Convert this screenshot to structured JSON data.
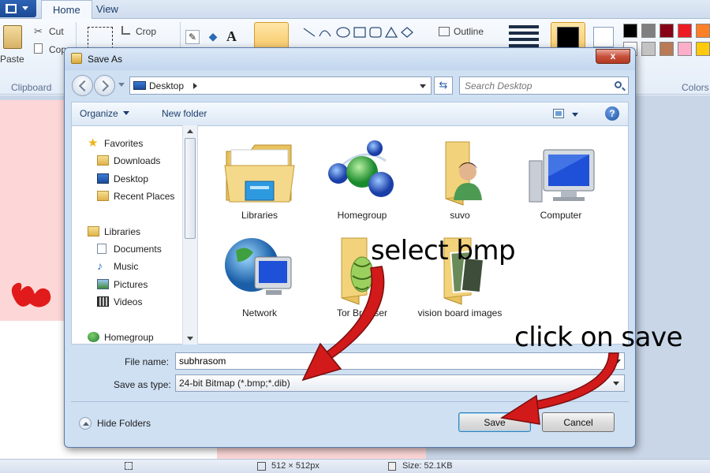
{
  "paint": {
    "tabs": [
      "Home",
      "View"
    ],
    "ribbon": {
      "paste_label": "Paste",
      "cut_label": "Cut",
      "copy_label": "Cop",
      "crop_label": "Crop",
      "outline_label": "Outline",
      "clipboard_group": "Clipboard",
      "colors_group": "Colors"
    },
    "palette": [
      "#000000",
      "#7f7f7f",
      "#880015",
      "#ed1c24",
      "#ff7f27",
      "#ffffff",
      "#c3c3c3",
      "#b97a57",
      "#ffaec9",
      "#ffc90e"
    ],
    "status": {
      "dimensions": "512 × 512px",
      "size": "Size: 52.1KB"
    }
  },
  "dialog": {
    "title": "Save As",
    "close_label": "x",
    "address": {
      "location": "Desktop"
    },
    "search": {
      "placeholder": "Search Desktop"
    },
    "toolbar": {
      "organize_label": "Organize",
      "new_folder_label": "New folder",
      "help_label": "?"
    },
    "nav_pane": {
      "items": [
        {
          "label": "Favorites",
          "icon": "star-icon"
        },
        {
          "label": "Downloads",
          "icon": "downloads-folder-icon"
        },
        {
          "label": "Desktop",
          "icon": "desktop-icon"
        },
        {
          "label": "Recent Places",
          "icon": "recent-places-icon"
        },
        {
          "label": "Libraries",
          "icon": "libraries-icon"
        },
        {
          "label": "Documents",
          "icon": "documents-icon"
        },
        {
          "label": "Music",
          "icon": "music-icon"
        },
        {
          "label": "Pictures",
          "icon": "pictures-icon"
        },
        {
          "label": "Videos",
          "icon": "videos-icon"
        },
        {
          "label": "Homegroup",
          "icon": "homegroup-icon"
        }
      ]
    },
    "files": [
      {
        "label": "Libraries",
        "icon": "libraries-folder-icon"
      },
      {
        "label": "Homegroup",
        "icon": "homegroup-spheres-icon"
      },
      {
        "label": "suvo",
        "icon": "user-folder-icon"
      },
      {
        "label": "Computer",
        "icon": "computer-icon"
      },
      {
        "label": "Network",
        "icon": "network-globe-icon"
      },
      {
        "label": "Tor Browser",
        "icon": "tor-folder-icon"
      },
      {
        "label": "vision board images",
        "icon": "image-folder-icon"
      }
    ],
    "form": {
      "file_name_label": "File name:",
      "file_name_value": "subhrasom",
      "save_type_label": "Save as type:",
      "save_type_value": "24-bit Bitmap (*.bmp;*.dib)"
    },
    "hide_folders_label": "Hide Folders",
    "save_label": "Save",
    "cancel_label": "Cancel"
  },
  "annotations": {
    "select_text": "select bmp",
    "save_text": "click on save",
    "arrow_color": "#d21a1a"
  }
}
